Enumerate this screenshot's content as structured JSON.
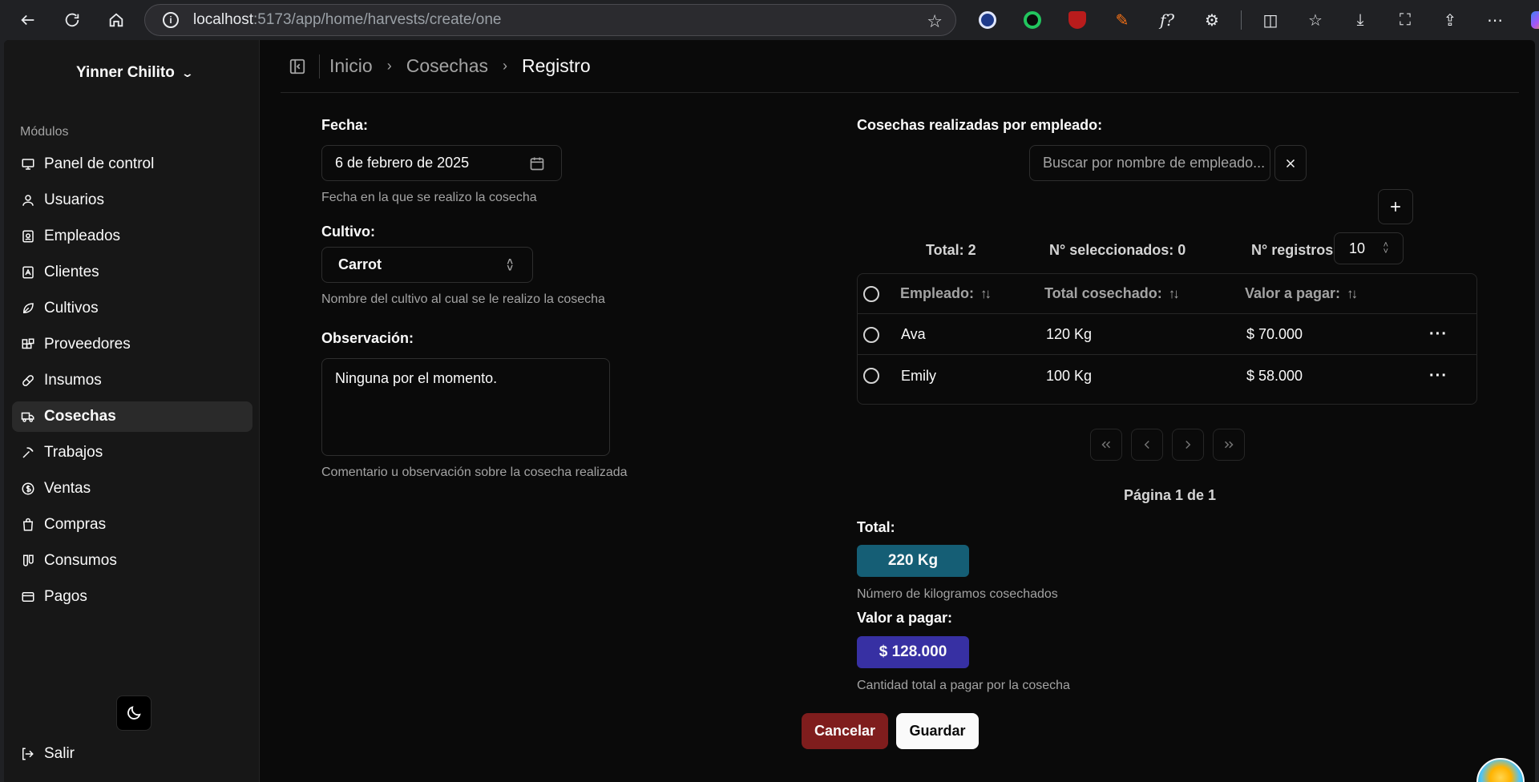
{
  "browser": {
    "url_host": "localhost",
    "url_path": ":5173/app/home/harvests/create/one"
  },
  "sidebar": {
    "user_name": "Yinner Chilito",
    "modules_label": "Módulos",
    "items": [
      {
        "label": "Panel de control",
        "icon": "monitor-icon"
      },
      {
        "label": "Usuarios",
        "icon": "user-icon"
      },
      {
        "label": "Empleados",
        "icon": "badge-icon"
      },
      {
        "label": "Clientes",
        "icon": "contact-icon"
      },
      {
        "label": "Cultivos",
        "icon": "leaf-icon"
      },
      {
        "label": "Proveedores",
        "icon": "blocks-icon"
      },
      {
        "label": "Insumos",
        "icon": "pill-icon"
      },
      {
        "label": "Cosechas",
        "icon": "truck-icon",
        "active": true
      },
      {
        "label": "Trabajos",
        "icon": "pickaxe-icon"
      },
      {
        "label": "Ventas",
        "icon": "dollar-icon"
      },
      {
        "label": "Compras",
        "icon": "bag-icon"
      },
      {
        "label": "Consumos",
        "icon": "flask-icon"
      },
      {
        "label": "Pagos",
        "icon": "card-icon"
      }
    ],
    "logout_label": "Salir"
  },
  "breadcrumb": [
    "Inicio",
    "Cosechas",
    "Registro"
  ],
  "form": {
    "date_label": "Fecha:",
    "date_value": "6 de febrero de 2025",
    "date_help": "Fecha en la que se realizo la cosecha",
    "crop_label": "Cultivo:",
    "crop_value": "Carrot",
    "crop_help": "Nombre del cultivo al cual se le realizo la cosecha",
    "obs_label": "Observación:",
    "obs_value": "Ninguna por el momento.",
    "obs_help": "Comentario u observación sobre la cosecha realizada"
  },
  "harvests": {
    "title": "Cosechas realizadas por empleado:",
    "search_placeholder": "Buscar por nombre de empleado...",
    "total_text": "Total: 2",
    "selected_text": "N° seleccionados: 0",
    "records_label": "N° registros",
    "records_value": "10",
    "columns": [
      "Empleado:",
      "Total cosechado:",
      "Valor a pagar:"
    ],
    "rows": [
      {
        "employee": "Ava",
        "total": "120 Kg",
        "value": "$ 70.000"
      },
      {
        "employee": "Emily",
        "total": "100 Kg",
        "value": "$ 58.000"
      }
    ],
    "page_info": "Página 1 de 1"
  },
  "summary": {
    "total_label": "Total:",
    "total_value": "220 Kg",
    "total_help": "Número de kilogramos cosechados",
    "pay_label": "Valor a pagar:",
    "pay_value": "$ 128.000",
    "pay_help": "Cantidad total a pagar por la cosecha"
  },
  "actions": {
    "cancel": "Cancelar",
    "save": "Guardar"
  },
  "colors": {
    "total_badge": "#155e75",
    "pay_badge": "#3730a3",
    "cancel_button": "#7f1d1d",
    "save_button": "#fafafa"
  }
}
